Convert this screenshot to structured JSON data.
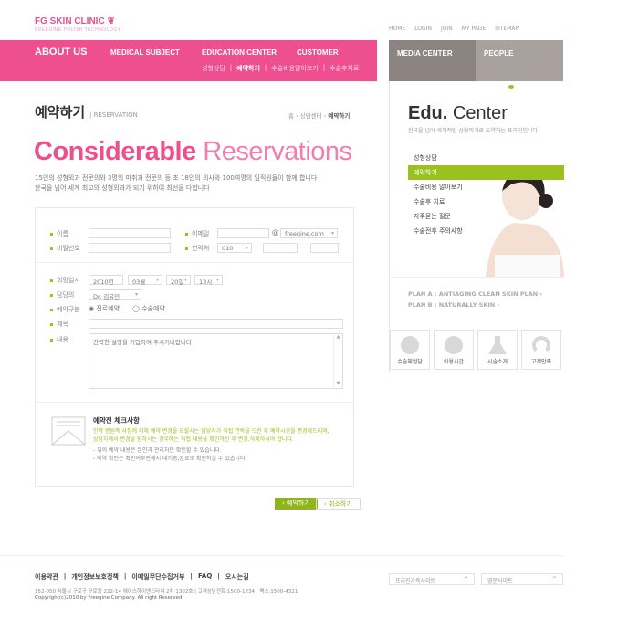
{
  "brand": {
    "name": "FG SKIN CLINIC",
    "tagline": "FREEGINE POLISH TECHNOLOGY"
  },
  "top_links": [
    "HOME",
    "LOGIN",
    "JOIN",
    "MY PAGE",
    "SITEMAP"
  ],
  "main_nav": [
    "ABOUT US",
    "MEDICAL SUBJECT",
    "EDUCATION CENTER",
    "CUSTOMER"
  ],
  "sub_nav": [
    "성형상담",
    "예약하기",
    "수술비용알아보기",
    "수술후치료"
  ],
  "side_tabs": [
    "MEDIA CENTER",
    "PEOPLE"
  ],
  "page": {
    "title": "예약하기",
    "subtitle": "RESERVATION",
    "breadcrumb": [
      "홈",
      "상담센터",
      "예약하기"
    ],
    "headline_bold": "Considerable",
    "headline_light": "Reservations",
    "desc1": "15인의 성형외과 전문의와 3명의 마취과 전문의 등 초 18인의 의사와 100여명의 임직원들이 함께 합니다",
    "desc2": "한국을 넘어 세계 최고의 성형외과가 되기 위하여 최선을 다합니다"
  },
  "form": {
    "name_label": "이름",
    "email_label": "이메일",
    "email_at": "@",
    "email_domain": "freegine.com",
    "password_label": "비밀번호",
    "phone_label": "연락처",
    "phone_prefix": "010",
    "dash": "-",
    "date_label": "희망일시",
    "year": "2010년",
    "month": "03월",
    "day": "20일",
    "hour": "13시",
    "doctor_label": "담당의",
    "doctor": "Dr. 김유민",
    "type_label": "예약구분",
    "type_options": [
      "진료예약",
      "수술예약"
    ],
    "type_selected": "진료예약",
    "title_label": "제목",
    "content_label": "내용",
    "content_placeholder": "간략한 설명을 기입하여 주시기바랍니다"
  },
  "notice": {
    "title": "예약전 체크사항",
    "hl1": "만약 병원측 사정에 의해 예약 변경을 요할시는 담당자가 직접 연락을 드린 후 예약시간을 변경해드리며,",
    "hl2": "상담자께서 변경을 원하시는 경우에는 직접 내용을 확인하신 후 변경,삭제하셔야 합니다.",
    "n1": "- 위의 예약 내용은 본인과 관리자만 확인할 수 있습니다.",
    "n2": "- 예약 확인은 확인여부란에서 대기중,완료로 확인하실 수 있습니다."
  },
  "buttons": {
    "submit": "예약하기",
    "cancel": "취소하기"
  },
  "side": {
    "title_bold": "Edu.",
    "title_light": "Center",
    "desc": "한국을 넘어 세계적인 성형외과로 도약하는 프리진입니다",
    "menu": [
      "성형상담",
      "예약하기",
      "수술비용 알아보기",
      "수술후 치료",
      "자주묻는 질문",
      "수술전후 주의사항"
    ],
    "active": "예약하기",
    "plans": [
      "PLAN A : ANTIAGING CLEAN SKIN PLAN",
      "PLAN B : NATURALLY SKIN"
    ],
    "quick": [
      {
        "label": "수술체험담",
        "icon": "chat-bubble"
      },
      {
        "label": "이용시간",
        "icon": "alarm-clock"
      },
      {
        "label": "시술소개",
        "icon": "flask"
      },
      {
        "label": "고객만족",
        "icon": "headset"
      }
    ]
  },
  "footer": {
    "links": [
      "이용약관",
      "개인정보보호정책",
      "이메일무단수집거부",
      "FAQ",
      "오시는길"
    ],
    "address": "152-050 서울시 구로구 구로동 222-14 에이스하이엔드타워 2차 1302호 | 고객상담전화:1500-1234 | 팩스:1500-4321",
    "copyright": "Copyright(c)2010 by Freegine Company. All right Reserved.",
    "family_site": "프리진가족사이트",
    "english_site": "영문사이트"
  },
  "colors": {
    "pink": "#ee4f8f",
    "green": "#9ac21e",
    "gray_dark": "#8b8480",
    "gray_light": "#a8a19d"
  }
}
